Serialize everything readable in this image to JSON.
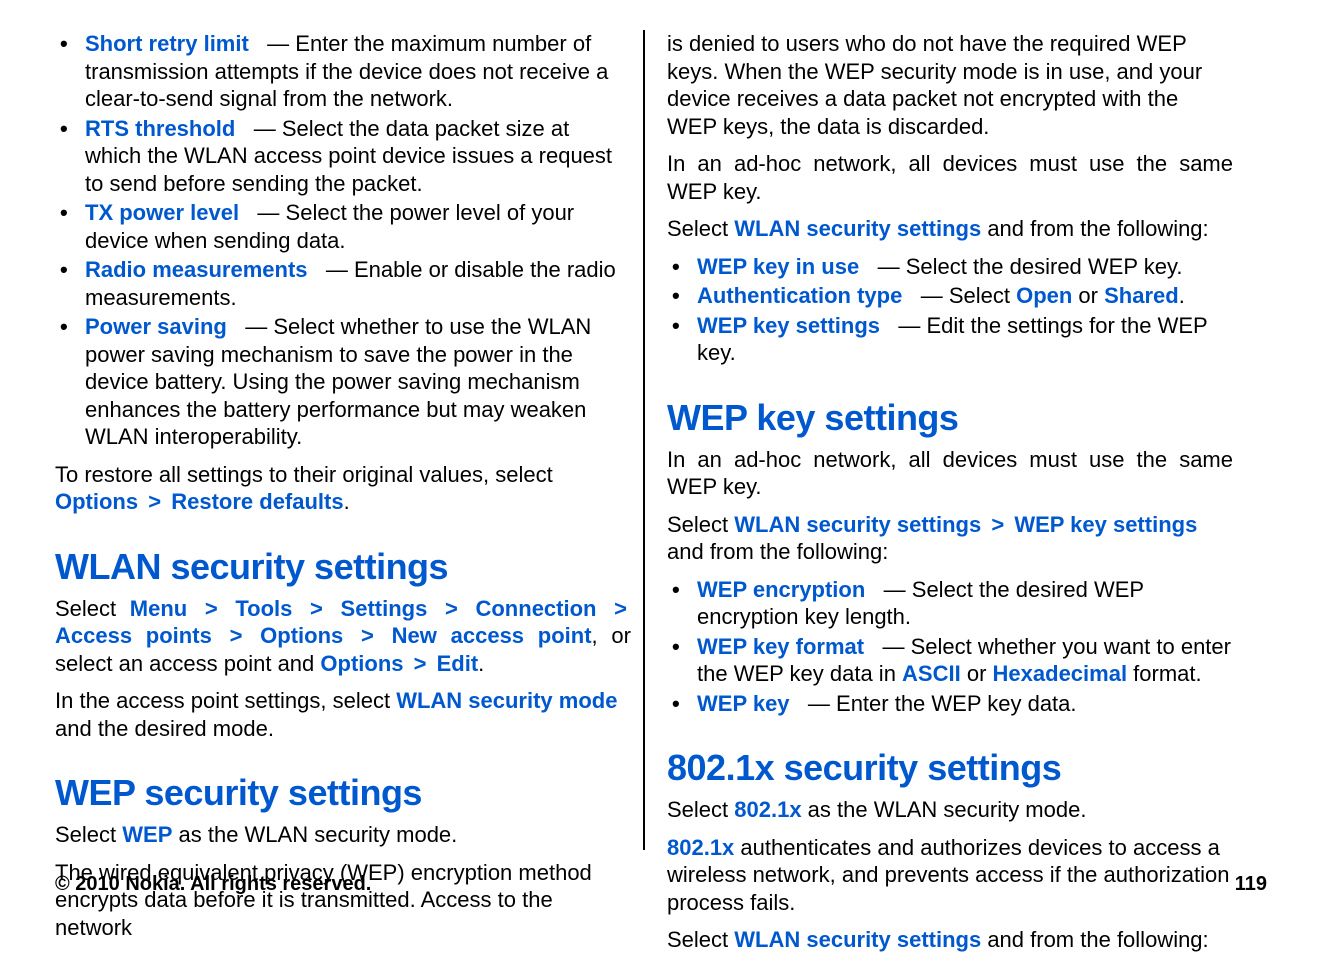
{
  "left": {
    "items": [
      {
        "term": "Short retry limit",
        "desc": "Enter the maximum number of transmission attempts if the device does not receive a clear-to-send signal from the network."
      },
      {
        "term": "RTS threshold",
        "desc": "Select the data packet size at which the WLAN access point device issues a request to send before sending the packet."
      },
      {
        "term": "TX power level",
        "desc": "Select the power level of your device when sending data."
      },
      {
        "term": "Radio measurements",
        "desc": "Enable or disable the radio measurements."
      },
      {
        "term": "Power saving",
        "desc": "Select whether to use the WLAN power saving mechanism to save the power in the device battery. Using the power saving mechanism enhances the battery performance but may weaken WLAN interoperability."
      }
    ],
    "restore_intro": "To restore all settings to their original values, select ",
    "restore_options": "Options",
    "restore_defaults": "Restore defaults",
    "restore_end": ".",
    "wlan_heading": "WLAN security settings",
    "wlan_p1_a": "Select ",
    "wlan_path": [
      "Menu",
      "Tools",
      "Settings",
      "Connection",
      "Access points",
      "Options",
      "New access point"
    ],
    "wlan_p1_b": ", or select an access point and ",
    "wlan_path2": [
      "Options",
      "Edit"
    ],
    "wlan_p1_c": ".",
    "wlan_p2_a": "In the access point settings, select ",
    "wlan_p2_link": "WLAN security mode",
    "wlan_p2_b": " and the desired mode.",
    "wep_heading": "WEP security settings",
    "wep_p1_a": "Select ",
    "wep_p1_link": "WEP",
    "wep_p1_b": " as the WLAN security mode.",
    "wep_p2": "The wired equivalent privacy (WEP) encryption method encrypts data before it is transmitted. Access to the network "
  },
  "right": {
    "cont1": "is denied to users who do not have the required WEP keys. When the WEP security mode is in use, and your device receives a data packet not encrypted with the WEP keys, the data is discarded.",
    "adhoc": "In an ad-hoc network, all devices must use the same WEP key.",
    "sel1_a": "Select ",
    "sel1_link": "WLAN security settings",
    "sel1_b": " and from the following:",
    "wep_list": [
      {
        "term": "WEP key in use",
        "desc": "Select the desired WEP key."
      }
    ],
    "auth_term": "Authentication type",
    "auth_mid": "Select ",
    "auth_open": "Open",
    "auth_or": " or ",
    "auth_shared": "Shared",
    "auth_end": ".",
    "wepset_term": "WEP key settings",
    "wepset_desc": "Edit the settings for the WEP key.",
    "wepkey_heading": "WEP key settings",
    "adhoc2": "In an ad-hoc network, all devices must use the same WEP key.",
    "sel2_a": "Select ",
    "sel2_link1": "WLAN security settings",
    "sel2_link2": "WEP key settings",
    "sel2_b": " and from the following:",
    "wepkey_list1_term": "WEP encryption",
    "wepkey_list1_desc": "Select the desired WEP encryption key length.",
    "wepkey_list2_term": "WEP key format",
    "wepkey_list2_a": "Select whether you want to enter the WEP key data in ",
    "wepkey_list2_ascii": "ASCII",
    "wepkey_list2_or": " or ",
    "wepkey_list2_hex": "Hexadecimal",
    "wepkey_list2_b": " format.",
    "wepkey_list3_term": "WEP key",
    "wepkey_list3_desc": "Enter the WEP key data.",
    "x_heading": "802.1x security settings",
    "x_p1_a": "Select ",
    "x_p1_link": "802.1x",
    "x_p1_b": " as the WLAN security mode.",
    "x_p2_link": "802.1x",
    "x_p2_b": " authenticates and authorizes devices to access a wireless network, and prevents access if the authorization process fails.",
    "x_sel_a": "Select ",
    "x_sel_link": "WLAN security settings",
    "x_sel_b": " and from the following:"
  },
  "footer": {
    "copyright": "© 2010 Nokia. All rights reserved.",
    "page": "119"
  },
  "gt": ">"
}
